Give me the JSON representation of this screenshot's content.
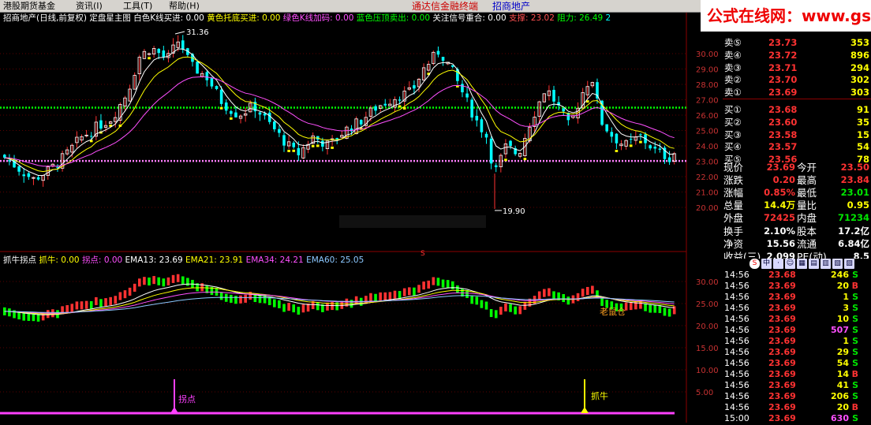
{
  "menubar": {
    "items": [
      "港股期货基金",
      "资讯(I)",
      "工具(T)",
      "帮助(H)"
    ],
    "app_title": "通达信金融终端",
    "stock_title": "招商地产"
  },
  "logo": {
    "text": "公式在线网：www.gszx.com.cn"
  },
  "main_chart": {
    "header": [
      {
        "text": "招商地产(日线,前复权) 定盘星主图",
        "color": "#ffffff"
      },
      {
        "text": "白色K线买进: 0.00",
        "color": "#ffffff"
      },
      {
        "text": "黄色托底买进: 0.00",
        "color": "#ffff00"
      },
      {
        "text": "绿色K线加码: 0.00",
        "color": "#ff50ff"
      },
      {
        "text": "蓝色压顶卖出: 0.00",
        "color": "#00ff00"
      },
      {
        "text": "关注信号重合: 0.00",
        "color": "#ffffff"
      },
      {
        "text": "支撑: 23.02",
        "color": "#ff5050"
      },
      {
        "text": "阻力: 26.49",
        "color": "#00ff00"
      },
      {
        "text": "2",
        "color": "#00ffff"
      }
    ],
    "y_ticks": [
      "30.00",
      "29.00",
      "28.00",
      "27.00",
      "26.00",
      "25.00",
      "24.00",
      "23.00",
      "22.00",
      "21.00",
      "20.00"
    ],
    "high_label": "31.36",
    "low_label": "19.90",
    "s_marker": "S",
    "green_dotted_level": 26.49,
    "pink_dotted_level": 23.02
  },
  "indicator": {
    "header": [
      {
        "text": "抓牛拐点",
        "color": "#ffffff"
      },
      {
        "text": "抓牛: 0.00",
        "color": "#ffff00"
      },
      {
        "text": "拐点: 0.00",
        "color": "#ff50ff"
      },
      {
        "text": "EMA13: 23.69",
        "color": "#ffffff"
      },
      {
        "text": "EMA21: 23.91",
        "color": "#ffff00"
      },
      {
        "text": "EMA34: 24.21",
        "color": "#ff50ff"
      },
      {
        "text": "EMA60: 25.05",
        "color": "#8cc8ff"
      }
    ],
    "y_ticks": [
      "30.00",
      "25.00",
      "20.00",
      "15.00",
      "10.00",
      "5.00"
    ],
    "label_guaidian": "拐点",
    "label_zhuaniu": "抓牛",
    "label_laoshucang": "老鼠仓"
  },
  "order_book": [
    {
      "label": "卖⑤",
      "price": "23.73",
      "vol": "353"
    },
    {
      "label": "卖④",
      "price": "23.72",
      "vol": "896"
    },
    {
      "label": "卖③",
      "price": "23.71",
      "vol": "294"
    },
    {
      "label": "卖②",
      "price": "23.70",
      "vol": "302"
    },
    {
      "label": "卖①",
      "price": "23.69",
      "vol": "303"
    },
    {
      "label": "买①",
      "price": "23.68",
      "vol": "91"
    },
    {
      "label": "买②",
      "price": "23.60",
      "vol": "35"
    },
    {
      "label": "买③",
      "price": "23.58",
      "vol": "15"
    },
    {
      "label": "买④",
      "price": "23.57",
      "vol": "54"
    },
    {
      "label": "买⑤",
      "price": "23.56",
      "vol": "78"
    }
  ],
  "stats": [
    {
      "l1": "现价",
      "v1": "23.69",
      "c1": "red",
      "l2": "今开",
      "v2": "23.50",
      "c2": "red"
    },
    {
      "l1": "涨跌",
      "v1": "0.20",
      "c1": "red",
      "l2": "最高",
      "v2": "23.84",
      "c2": "red"
    },
    {
      "l1": "涨幅",
      "v1": "0.85%",
      "c1": "red",
      "l2": "最低",
      "v2": "23.01",
      "c2": "grn"
    },
    {
      "l1": "总量",
      "v1": "14.4万",
      "c1": "yel",
      "l2": "量比",
      "v2": "0.95",
      "c2": "yel"
    },
    {
      "l1": "外盘",
      "v1": "72425",
      "c1": "red",
      "l2": "内盘",
      "v2": "71234",
      "c2": "grn"
    },
    {
      "l1": "换手",
      "v1": "2.10%",
      "c1": "wht",
      "l2": "股本",
      "v2": "17.2亿",
      "c2": "wht"
    },
    {
      "l1": "净资",
      "v1": "15.56",
      "c1": "wht",
      "l2": "流通",
      "v2": "6.84亿",
      "c2": "wht"
    },
    {
      "l1": "收益(三)",
      "v1": "2.099",
      "c1": "wht",
      "l2": "PE(动)",
      "v2": "8.5",
      "c2": "wht"
    }
  ],
  "toolbar_icons": [
    "S",
    "中",
    "·",
    "☺",
    "▦",
    "▤",
    "▥",
    "▧",
    "▨"
  ],
  "ticks": [
    {
      "time": "14:56",
      "price": "23.68",
      "vol": "246",
      "side": "S"
    },
    {
      "time": "14:56",
      "price": "23.69",
      "vol": "20",
      "side": "B"
    },
    {
      "time": "14:56",
      "price": "23.69",
      "vol": "1",
      "side": "S"
    },
    {
      "time": "14:56",
      "price": "23.69",
      "vol": "3",
      "side": "S"
    },
    {
      "time": "14:56",
      "price": "23.69",
      "vol": "10",
      "side": "S"
    },
    {
      "time": "14:56",
      "price": "23.69",
      "vol": "507",
      "side": "S"
    },
    {
      "time": "14:56",
      "price": "23.69",
      "vol": "1",
      "side": "S"
    },
    {
      "time": "14:56",
      "price": "23.69",
      "vol": "29",
      "side": "S"
    },
    {
      "time": "14:56",
      "price": "23.69",
      "vol": "54",
      "side": "S"
    },
    {
      "time": "14:56",
      "price": "23.69",
      "vol": "14",
      "side": "B"
    },
    {
      "time": "14:56",
      "price": "23.69",
      "vol": "41",
      "side": "S"
    },
    {
      "time": "14:56",
      "price": "23.69",
      "vol": "206",
      "side": "S"
    },
    {
      "time": "14:56",
      "price": "23.69",
      "vol": "20",
      "side": "B"
    },
    {
      "time": "15:00",
      "price": "23.69",
      "vol": "630",
      "side": "S"
    }
  ],
  "colors": {
    "up": "#ff3232",
    "down": "#00ffff",
    "grid": "#8b0000"
  }
}
